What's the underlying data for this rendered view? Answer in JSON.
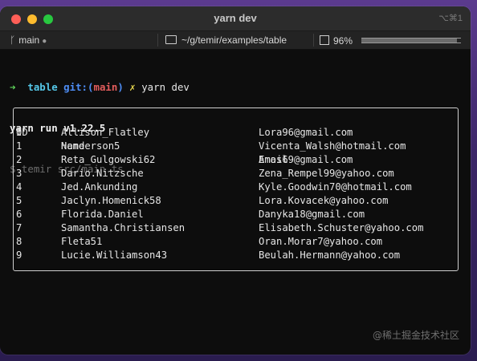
{
  "window": {
    "title": "yarn dev",
    "shortcut": "⌥⌘1"
  },
  "statusbar": {
    "branch": "main",
    "branch_dot": "●",
    "path": "~/g/temir/examples/table",
    "cpu": "96%",
    "cpu_fraction": 0.96
  },
  "terminal": {
    "prompt_arrow": "➜",
    "prompt_dir": "table",
    "prompt_git": "git:(",
    "prompt_branch": "main",
    "prompt_git_close": ")",
    "prompt_x": "✗",
    "command": "yarn dev",
    "yarn_line": "yarn run v1.22.5",
    "run_line": "$ temir src/main.ts"
  },
  "table": {
    "headers": [
      "ID",
      "Name",
      "Email"
    ],
    "rows": [
      [
        "0",
        "Allison_Flatley",
        "Lora96@gmail.com"
      ],
      [
        "1",
        "Henderson5",
        "Vicenta_Walsh@hotmail.com"
      ],
      [
        "2",
        "Reta_Gulgowski62",
        "Amos69@gmail.com"
      ],
      [
        "3",
        "Dario.Nitzsche",
        "Zena_Rempel99@yahoo.com"
      ],
      [
        "4",
        "Jed.Ankunding",
        "Kyle.Goodwin70@hotmail.com"
      ],
      [
        "5",
        "Jaclyn.Homenick58",
        "Lora.Kovacek@yahoo.com"
      ],
      [
        "6",
        "Florida.Daniel",
        "Danyka18@gmail.com"
      ],
      [
        "7",
        "Samantha.Christiansen",
        "Elisabeth.Schuster@yahoo.com"
      ],
      [
        "8",
        "Fleta51",
        "Oran.Morar7@yahoo.com"
      ],
      [
        "9",
        "Lucie.Williamson43",
        "Beulah.Hermann@yahoo.com"
      ]
    ]
  },
  "watermark": "@稀土掘金技术社区"
}
